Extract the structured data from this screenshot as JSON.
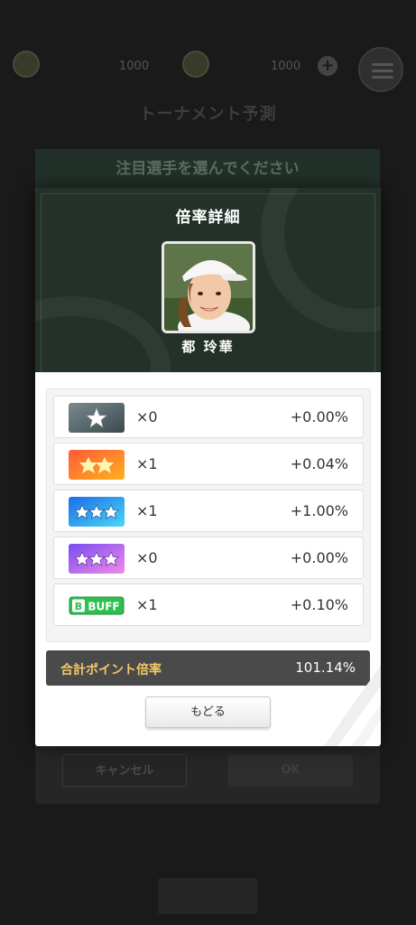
{
  "background": {
    "currency_1": "1000",
    "currency_2": "1000",
    "page_title": "トーナメント予測",
    "dialog_title": "注目選手を選んでください",
    "cancel_label": "キャンセル",
    "ok_label": "OK"
  },
  "modal": {
    "title": "倍率詳細",
    "player_name": "都 玲華",
    "rows": [
      {
        "badge": "silver-star-icon",
        "multiplier": "×0",
        "value": "+0.00%"
      },
      {
        "badge": "two-gold-stars-icon",
        "multiplier": "×1",
        "value": "+0.04%"
      },
      {
        "badge": "three-blue-stars-icon",
        "multiplier": "×1",
        "value": "+1.00%"
      },
      {
        "badge": "three-purple-stars-icon",
        "multiplier": "×0",
        "value": "+0.00%"
      },
      {
        "badge": "buff-icon",
        "badge_text": "BUFF",
        "multiplier": "×1",
        "value": "+0.10%"
      }
    ],
    "total_label": "合計ポイント倍率",
    "total_value": "101.14%",
    "back_label": "もどる"
  },
  "colors": {
    "header_bg": "#233129",
    "total_label": "#f3c767",
    "total_bg": "#4a4a4a"
  }
}
